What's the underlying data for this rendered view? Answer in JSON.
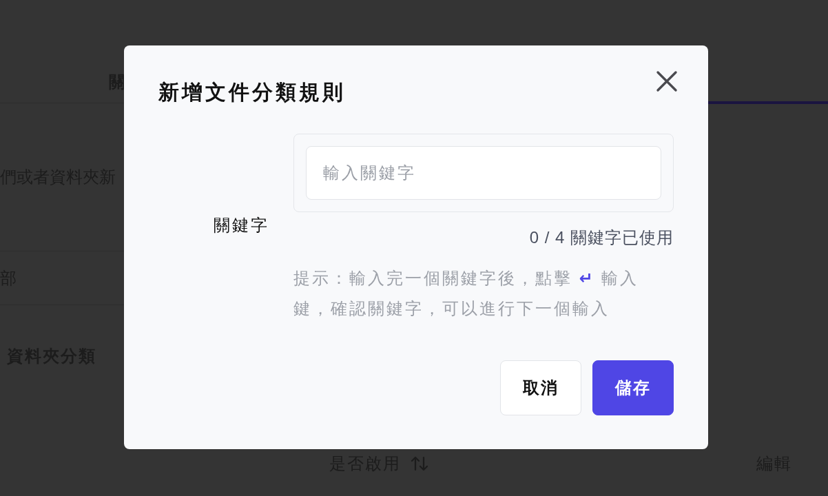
{
  "background": {
    "tab_label": "關",
    "description": "們或者資料夾新",
    "row_text": "部",
    "section_title": "資料夾分類",
    "columns": [
      {
        "label": "是否啟用",
        "sortable": true
      },
      {
        "label": "編輯",
        "sortable": false
      }
    ]
  },
  "dialog": {
    "title": "新增文件分類規則",
    "field_label": "關鍵字",
    "input": {
      "placeholder": "輸入關鍵字"
    },
    "counter": "0 / 4 關鍵字已使用",
    "hint": {
      "before": "提示：輸入完一個關鍵字後，點擊",
      "key_symbol": "↵",
      "after": "輸入鍵，確認關鍵字，可以進行下一個輸入"
    },
    "buttons": [
      {
        "label": "取消",
        "kind": "secondary"
      },
      {
        "label": "儲存",
        "kind": "primary"
      }
    ]
  }
}
